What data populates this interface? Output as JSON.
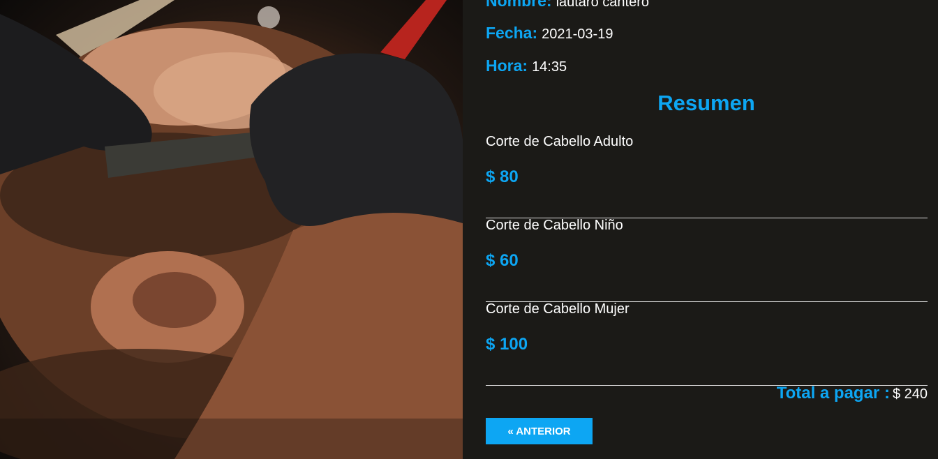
{
  "hero": {
    "image": "barber-shaving-beard-photo"
  },
  "cita": {
    "nombre_label": "Nombre:",
    "nombre_value": "lautaro cantero",
    "fecha_label": "Fecha:",
    "fecha_value": "2021-03-19",
    "hora_label": "Hora:",
    "hora_value": "14:35"
  },
  "resumen": {
    "title": "Resumen",
    "services": [
      {
        "name": "Corte de Cabello Adulto",
        "price": "$ 80"
      },
      {
        "name": "Corte de Cabello Niño",
        "price": "$ 60"
      },
      {
        "name": "Corte de Cabello Mujer",
        "price": "$ 100"
      }
    ],
    "total_label": "Total a pagar :",
    "total_value": "$ 240"
  },
  "nav": {
    "prev_label": "« ANTERIOR"
  },
  "colors": {
    "accent": "#0da6f3",
    "background": "#1b1a17",
    "text": "#ffffff"
  }
}
